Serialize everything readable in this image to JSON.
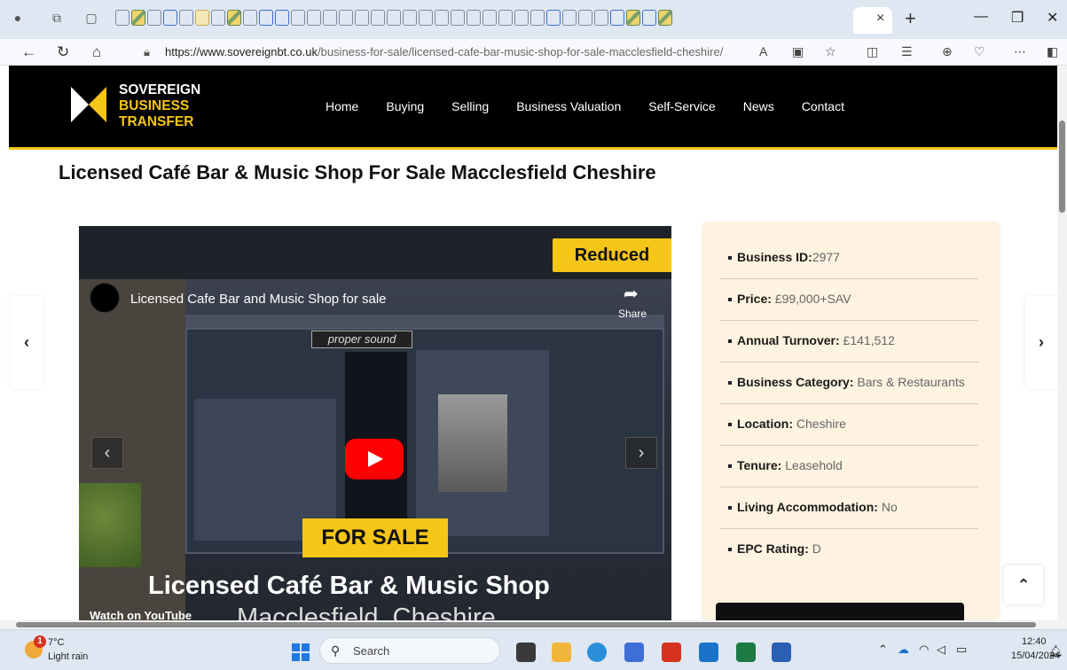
{
  "browser": {
    "url_domain": "https://www.sovereignbt.co.uk",
    "url_path": "/business-for-sale/licensed-cafe-bar-music-shop-for-sale-macclesfield-cheshire/",
    "tab_close": "×",
    "new_tab": "+"
  },
  "site": {
    "logo": [
      "SOVEREIGN",
      "BUSINESS",
      "TRANSFER"
    ],
    "nav": [
      "Home",
      "Buying",
      "Selling",
      "Business Valuation",
      "Self-Service",
      "News",
      "Contact"
    ],
    "brand_color": "#f5c518"
  },
  "page": {
    "title": "Licensed Café Bar & Music Shop For Sale Macclesfield Cheshire"
  },
  "video": {
    "badge": "Reduced",
    "yt_title": "Licensed Cafe Bar and Music Shop for sale",
    "share_label": "Share",
    "shop_sign": "proper sound",
    "for_sale": "FOR SALE",
    "headline": "Licensed Café Bar & Music Shop",
    "subline": "Macclesfield, Cheshire",
    "watch_on": "Watch on  YouTube"
  },
  "details": [
    {
      "label": "Business ID:",
      "value": "2977"
    },
    {
      "label": "Price:",
      "value": " £99,000+SAV"
    },
    {
      "label": "Annual Turnover:",
      "value": " £141,512"
    },
    {
      "label": "Business Category:",
      "value": " Bars & Restaurants"
    },
    {
      "label": "Location:",
      "value": " Cheshire"
    },
    {
      "label": "Tenure:",
      "value": " Leasehold"
    },
    {
      "label": "Living Accommodation:",
      "value": " No"
    },
    {
      "label": "EPC Rating:",
      "value": " D"
    }
  ],
  "taskbar": {
    "temp": "7°C",
    "weather": "Light rain",
    "weather_badge": "1",
    "search": "Search",
    "time": "12:40",
    "date": "15/04/2024"
  }
}
